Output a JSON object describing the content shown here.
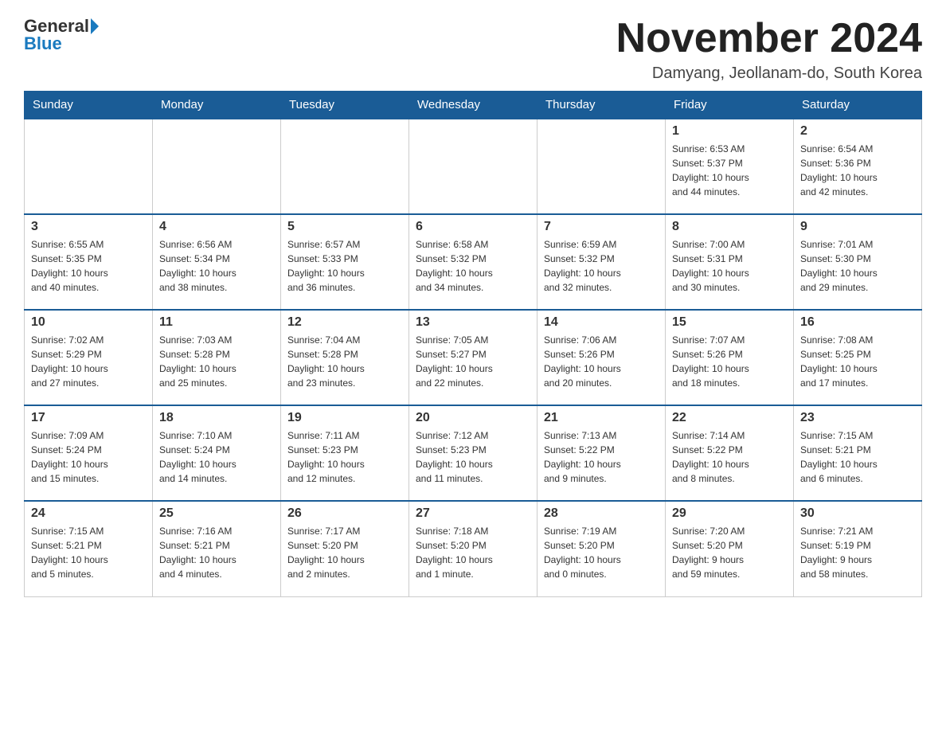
{
  "header": {
    "logo_general": "General",
    "logo_blue": "Blue",
    "month_title": "November 2024",
    "location": "Damyang, Jeollanam-do, South Korea"
  },
  "weekdays": [
    "Sunday",
    "Monday",
    "Tuesday",
    "Wednesday",
    "Thursday",
    "Friday",
    "Saturday"
  ],
  "weeks": [
    [
      {
        "day": "",
        "info": ""
      },
      {
        "day": "",
        "info": ""
      },
      {
        "day": "",
        "info": ""
      },
      {
        "day": "",
        "info": ""
      },
      {
        "day": "",
        "info": ""
      },
      {
        "day": "1",
        "info": "Sunrise: 6:53 AM\nSunset: 5:37 PM\nDaylight: 10 hours\nand 44 minutes."
      },
      {
        "day": "2",
        "info": "Sunrise: 6:54 AM\nSunset: 5:36 PM\nDaylight: 10 hours\nand 42 minutes."
      }
    ],
    [
      {
        "day": "3",
        "info": "Sunrise: 6:55 AM\nSunset: 5:35 PM\nDaylight: 10 hours\nand 40 minutes."
      },
      {
        "day": "4",
        "info": "Sunrise: 6:56 AM\nSunset: 5:34 PM\nDaylight: 10 hours\nand 38 minutes."
      },
      {
        "day": "5",
        "info": "Sunrise: 6:57 AM\nSunset: 5:33 PM\nDaylight: 10 hours\nand 36 minutes."
      },
      {
        "day": "6",
        "info": "Sunrise: 6:58 AM\nSunset: 5:32 PM\nDaylight: 10 hours\nand 34 minutes."
      },
      {
        "day": "7",
        "info": "Sunrise: 6:59 AM\nSunset: 5:32 PM\nDaylight: 10 hours\nand 32 minutes."
      },
      {
        "day": "8",
        "info": "Sunrise: 7:00 AM\nSunset: 5:31 PM\nDaylight: 10 hours\nand 30 minutes."
      },
      {
        "day": "9",
        "info": "Sunrise: 7:01 AM\nSunset: 5:30 PM\nDaylight: 10 hours\nand 29 minutes."
      }
    ],
    [
      {
        "day": "10",
        "info": "Sunrise: 7:02 AM\nSunset: 5:29 PM\nDaylight: 10 hours\nand 27 minutes."
      },
      {
        "day": "11",
        "info": "Sunrise: 7:03 AM\nSunset: 5:28 PM\nDaylight: 10 hours\nand 25 minutes."
      },
      {
        "day": "12",
        "info": "Sunrise: 7:04 AM\nSunset: 5:28 PM\nDaylight: 10 hours\nand 23 minutes."
      },
      {
        "day": "13",
        "info": "Sunrise: 7:05 AM\nSunset: 5:27 PM\nDaylight: 10 hours\nand 22 minutes."
      },
      {
        "day": "14",
        "info": "Sunrise: 7:06 AM\nSunset: 5:26 PM\nDaylight: 10 hours\nand 20 minutes."
      },
      {
        "day": "15",
        "info": "Sunrise: 7:07 AM\nSunset: 5:26 PM\nDaylight: 10 hours\nand 18 minutes."
      },
      {
        "day": "16",
        "info": "Sunrise: 7:08 AM\nSunset: 5:25 PM\nDaylight: 10 hours\nand 17 minutes."
      }
    ],
    [
      {
        "day": "17",
        "info": "Sunrise: 7:09 AM\nSunset: 5:24 PM\nDaylight: 10 hours\nand 15 minutes."
      },
      {
        "day": "18",
        "info": "Sunrise: 7:10 AM\nSunset: 5:24 PM\nDaylight: 10 hours\nand 14 minutes."
      },
      {
        "day": "19",
        "info": "Sunrise: 7:11 AM\nSunset: 5:23 PM\nDaylight: 10 hours\nand 12 minutes."
      },
      {
        "day": "20",
        "info": "Sunrise: 7:12 AM\nSunset: 5:23 PM\nDaylight: 10 hours\nand 11 minutes."
      },
      {
        "day": "21",
        "info": "Sunrise: 7:13 AM\nSunset: 5:22 PM\nDaylight: 10 hours\nand 9 minutes."
      },
      {
        "day": "22",
        "info": "Sunrise: 7:14 AM\nSunset: 5:22 PM\nDaylight: 10 hours\nand 8 minutes."
      },
      {
        "day": "23",
        "info": "Sunrise: 7:15 AM\nSunset: 5:21 PM\nDaylight: 10 hours\nand 6 minutes."
      }
    ],
    [
      {
        "day": "24",
        "info": "Sunrise: 7:15 AM\nSunset: 5:21 PM\nDaylight: 10 hours\nand 5 minutes."
      },
      {
        "day": "25",
        "info": "Sunrise: 7:16 AM\nSunset: 5:21 PM\nDaylight: 10 hours\nand 4 minutes."
      },
      {
        "day": "26",
        "info": "Sunrise: 7:17 AM\nSunset: 5:20 PM\nDaylight: 10 hours\nand 2 minutes."
      },
      {
        "day": "27",
        "info": "Sunrise: 7:18 AM\nSunset: 5:20 PM\nDaylight: 10 hours\nand 1 minute."
      },
      {
        "day": "28",
        "info": "Sunrise: 7:19 AM\nSunset: 5:20 PM\nDaylight: 10 hours\nand 0 minutes."
      },
      {
        "day": "29",
        "info": "Sunrise: 7:20 AM\nSunset: 5:20 PM\nDaylight: 9 hours\nand 59 minutes."
      },
      {
        "day": "30",
        "info": "Sunrise: 7:21 AM\nSunset: 5:19 PM\nDaylight: 9 hours\nand 58 minutes."
      }
    ]
  ]
}
